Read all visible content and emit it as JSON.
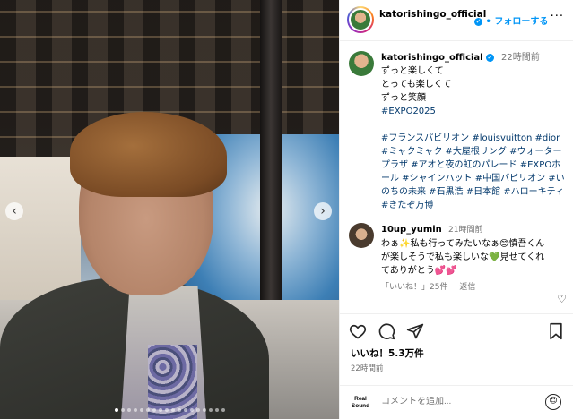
{
  "post": {
    "nav_left": "‹",
    "nav_right": "›",
    "dot_count": 18,
    "active_dot": 0
  },
  "header": {
    "username": "katorishingo_official",
    "verified_mark": "✓",
    "separator": "•",
    "follow_label": "フォローする",
    "more_label": "···"
  },
  "caption": {
    "username": "katorishingo_official",
    "time": "22時間前",
    "lines": [
      "ずっと楽しくて",
      "とっても楽しくて",
      "ずっと笑顔"
    ],
    "first_tag": "#EXPO2025",
    "tags": "#フランスパビリオン #louisvuitton #dior #ミャクミャク #大屋根リング #ウォータープラザ #アオと夜の虹のパレード #EXPOホール #シャインハット #中国パビリオン #いのちの未来 #石黒浩 #日本館 #ハローキティ #きたぞ万博"
  },
  "comment": {
    "username": "10up_yumin",
    "time": "21時間前",
    "text": "わぁ✨私も行ってみたいなぁ😊慎吾くんが楽しそうで私も楽しいな💚見せてくれてありがとう💕💕",
    "likes": "「いいね！」25件",
    "reply": "返信"
  },
  "actions": {
    "likes": "いいね！5.3万件",
    "time_ago": "22時間前",
    "icons": [
      "heart-icon",
      "comment-icon",
      "share-icon",
      "bookmark-icon"
    ]
  },
  "comment_box": {
    "logo_top": "Real",
    "logo_bottom": "Sound",
    "placeholder": "コメントを追加..."
  }
}
